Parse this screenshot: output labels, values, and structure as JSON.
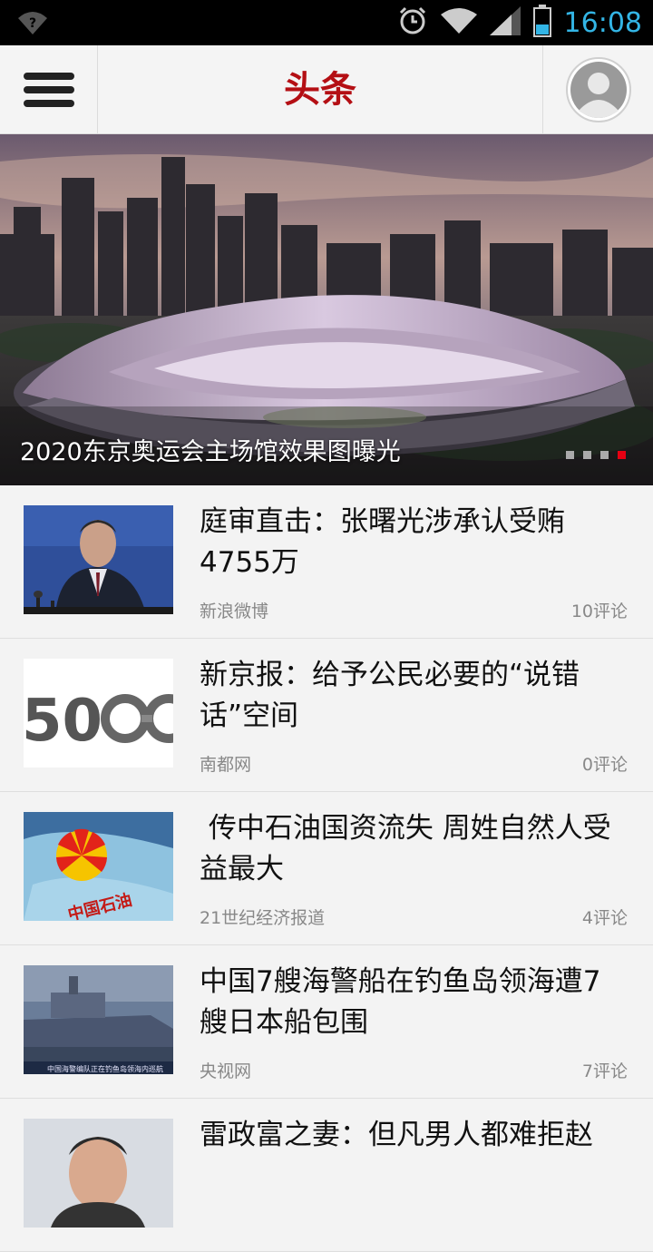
{
  "status_bar": {
    "time": "16:08"
  },
  "header": {
    "title": "头条"
  },
  "hero": {
    "caption": "2020东京奥运会主场馆效果图曝光",
    "slide_count": 4,
    "active_slide": 4
  },
  "news": [
    {
      "title": "庭审直击：张曙光涉承认受贿4755万",
      "source": "新浪微博",
      "comments": "10评论"
    },
    {
      "title": "新京报：给予公民必要的“说错话”空间",
      "source": "南都网",
      "comments": "0评论"
    },
    {
      "title": " 传中石油国资流失 周姓自然人受益最大",
      "source": "21世纪经济报道",
      "comments": "4评论"
    },
    {
      "title": "中国7艘海警船在钓鱼岛领海遭7艘日本船包围",
      "source": "央视网",
      "comments": "7评论"
    },
    {
      "title": "雷政富之妻：但凡男人都难拒赵",
      "source": "",
      "comments": ""
    }
  ],
  "thumb_texts": {
    "handcuff_number": "50",
    "petrochina_label": "中国石油",
    "ship_caption": "中国海警编队正在钓鱼岛领海内巡航"
  },
  "colors": {
    "accent": "#b40f14",
    "status_time": "#33b5e5",
    "active_dot": "#e60012"
  }
}
